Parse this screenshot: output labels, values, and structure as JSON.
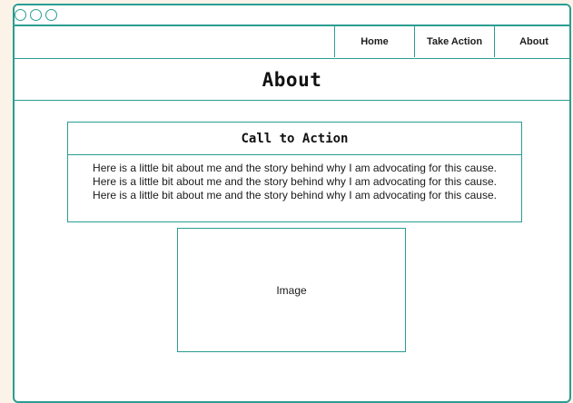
{
  "window": {
    "controls": [
      "circle",
      "circle",
      "circle"
    ]
  },
  "nav": {
    "items": [
      {
        "label": "Home"
      },
      {
        "label": "Take Action"
      },
      {
        "label": "About"
      }
    ]
  },
  "header": {
    "title": "About"
  },
  "card": {
    "title": "Call to Action",
    "lines": [
      "Here is a little bit about me and the story behind why I am advocating for this cause.",
      "Here is a little bit about me and the story behind why I am advocating for this cause.",
      "Here is a little bit about me and the story behind why I am advocating for this cause."
    ]
  },
  "image": {
    "label": "Image"
  },
  "colors": {
    "accent": "#2a9d93",
    "background": "#fbf3e8"
  }
}
